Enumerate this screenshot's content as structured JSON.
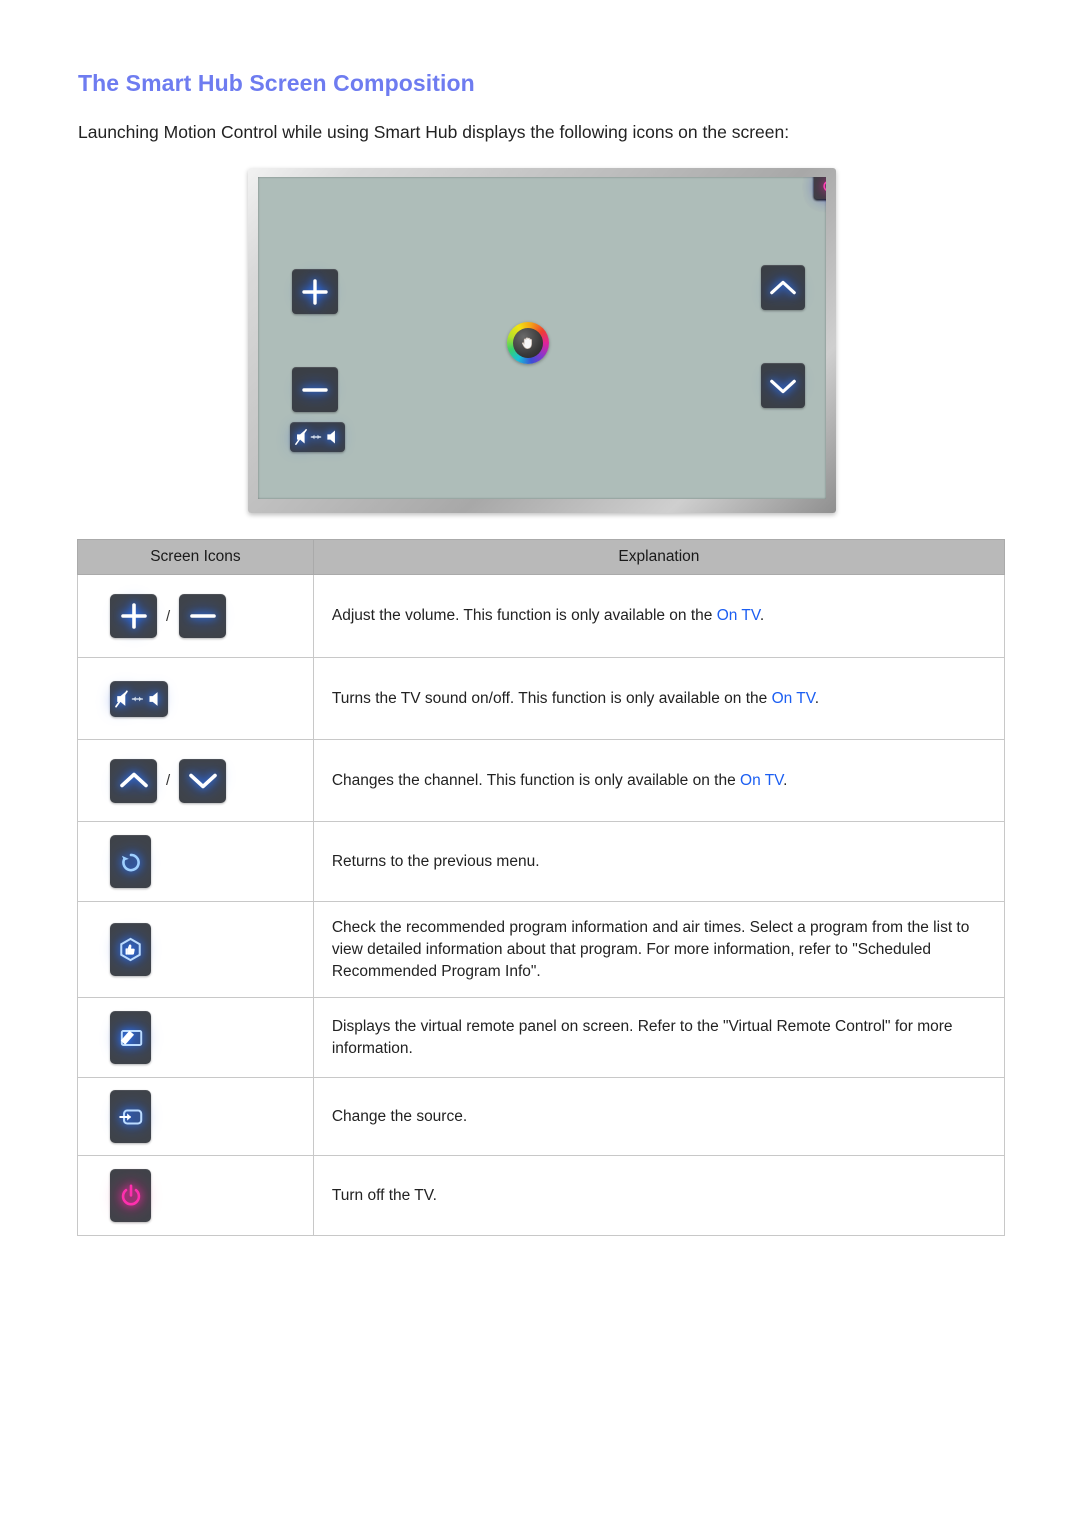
{
  "heading": "The Smart Hub Screen Composition",
  "intro": "Launching Motion Control while using Smart Hub displays the following icons on the screen:",
  "colors": {
    "heading": "#6e7cf0",
    "link": "#1b5ef2",
    "icon_glow_blue": "#2f7bff",
    "icon_glow_pink": "#ff2fae",
    "key_background": "#3f4349",
    "table_header_background": "#b9b9b9",
    "tv_screen": "#aebdb9"
  },
  "tv_illustration": {
    "name": "smart-hub-motion-control-screen",
    "top_bar_icons": [
      "return-icon",
      "recommendation-icon",
      "virtual-remote-icon",
      "source-icon",
      "power-icon"
    ],
    "left_icons": [
      "volume-up-icon",
      "volume-down-icon",
      "mute-toggle-icon"
    ],
    "right_icons": [
      "channel-up-icon",
      "channel-down-icon"
    ],
    "center": "hand-cursor-icon"
  },
  "table": {
    "headers": [
      "Screen Icons",
      "Explanation"
    ],
    "rows": [
      {
        "icons": [
          "volume-up-icon",
          "volume-down-icon"
        ],
        "separator": "/",
        "text_before": "Adjust the volume. This function is only available on the ",
        "link": "On TV",
        "text_after": "."
      },
      {
        "icons": [
          "mute-toggle-icon"
        ],
        "separator": "",
        "text_before": "Turns the TV sound on/off. This function is only available on the ",
        "link": "On TV",
        "text_after": "."
      },
      {
        "icons": [
          "channel-up-icon",
          "channel-down-icon"
        ],
        "separator": "/",
        "text_before": "Changes the channel. This function is only available on the ",
        "link": "On TV",
        "text_after": "."
      },
      {
        "icons": [
          "return-icon"
        ],
        "separator": "",
        "text_before": "Returns to the previous menu.",
        "link": "",
        "text_after": ""
      },
      {
        "icons": [
          "recommendation-icon"
        ],
        "separator": "",
        "text_before": "Check the recommended program information and air times. Select a program from the list to view detailed information about that program. For more information, refer to \"Scheduled Recommended Program Info\".",
        "link": "",
        "text_after": ""
      },
      {
        "icons": [
          "virtual-remote-icon"
        ],
        "separator": "",
        "text_before": "Displays the virtual remote panel on screen. Refer to the \"Virtual Remote Control\" for more information.",
        "link": "",
        "text_after": ""
      },
      {
        "icons": [
          "source-icon"
        ],
        "separator": "",
        "text_before": "Change the source.",
        "link": "",
        "text_after": ""
      },
      {
        "icons": [
          "power-icon"
        ],
        "separator": "",
        "text_before": "Turn off the TV.",
        "link": "",
        "text_after": ""
      }
    ]
  }
}
